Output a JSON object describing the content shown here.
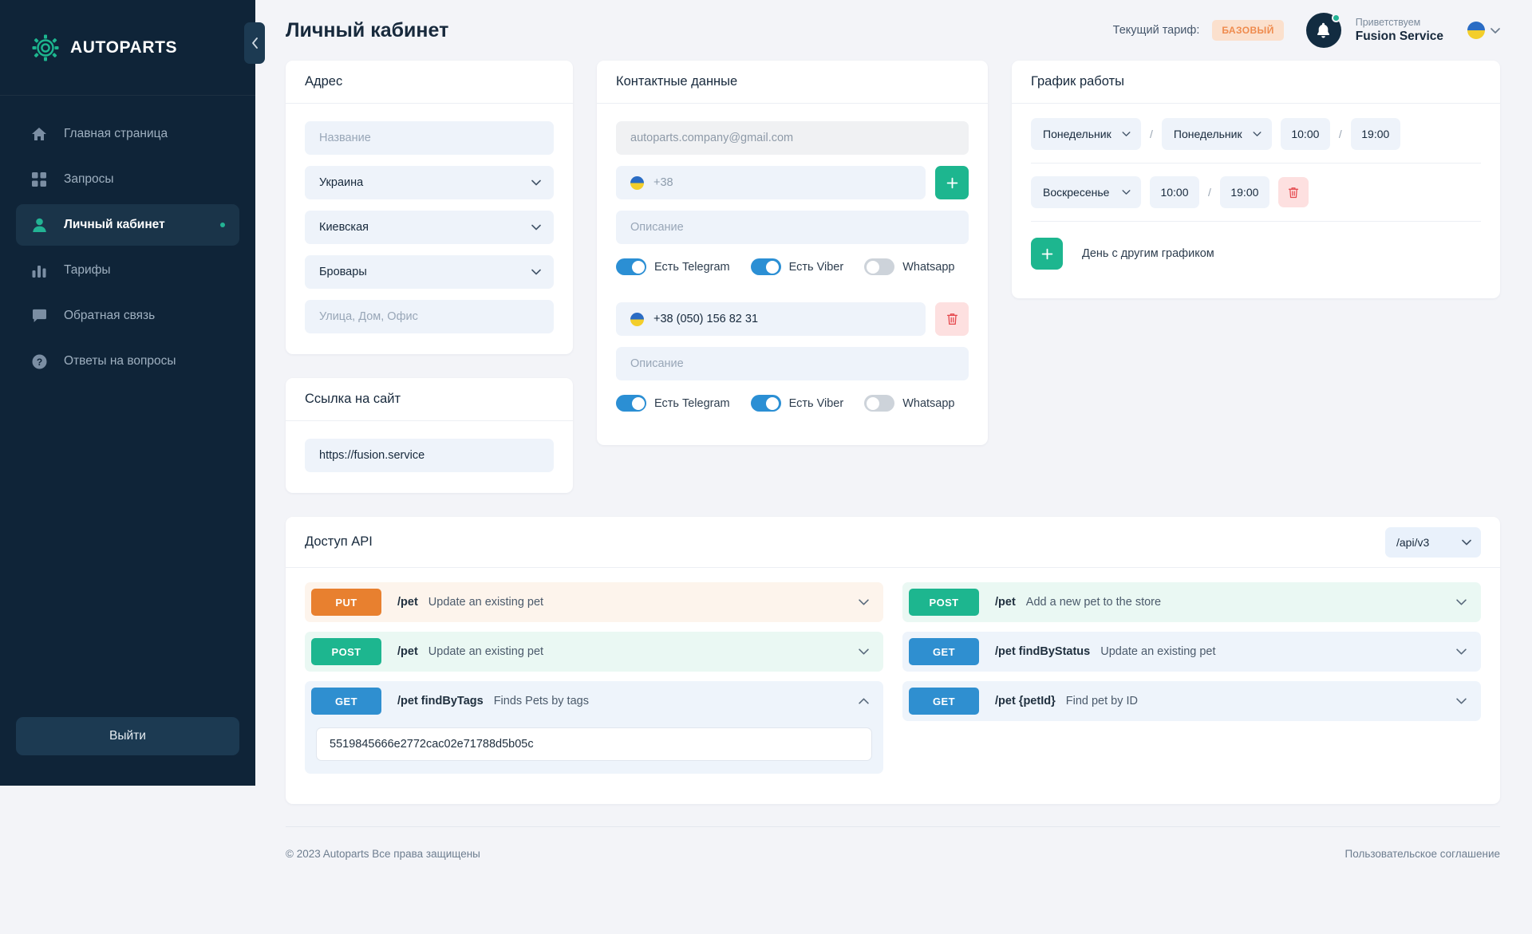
{
  "brand": {
    "name": "AUTOPARTS",
    "logo_icon": "gear-logo-icon"
  },
  "sidebar": {
    "collapse_icon": "chevron-left-icon",
    "items": [
      {
        "label": "Главная страница",
        "icon": "home-icon",
        "active": false
      },
      {
        "label": "Запросы",
        "icon": "grid-icon",
        "active": false
      },
      {
        "label": "Личный кабинет",
        "icon": "user-icon",
        "active": true
      },
      {
        "label": "Тарифы",
        "icon": "bar-chart-icon",
        "active": false
      },
      {
        "label": "Обратная связь",
        "icon": "chat-icon",
        "active": false
      },
      {
        "label": "Ответы на вопросы",
        "icon": "question-circle-icon",
        "active": false
      }
    ],
    "logout_label": "Выйти"
  },
  "header": {
    "page_title": "Личный кабинет",
    "tariff_label": "Текущий тариф:",
    "tariff_badge": "БАЗОВЫЙ",
    "bell_icon": "bell-icon",
    "greeting_small": "Приветствуем",
    "greeting_name": "Fusion Service",
    "lang_flag": "ukraine-flag-icon",
    "lang_chevron": "chevron-down-icon"
  },
  "address": {
    "title": "Адрес",
    "name_placeholder": "Название",
    "country": "Украина",
    "region": "Киевская",
    "city": "Бровары",
    "street_placeholder": "Улица, Дом, Офис"
  },
  "website": {
    "title": "Ссылка на сайт",
    "url": "https://fusion.service"
  },
  "contacts": {
    "title": "Контактные данные",
    "email_placeholder": "autoparts.company@gmail.com",
    "add_icon": "plus-icon",
    "delete_icon": "trash-icon",
    "blocks": [
      {
        "phone": "+38",
        "phone_is_placeholder": true,
        "description_placeholder": "Описание",
        "action": "add",
        "toggles": [
          {
            "label": "Есть Telegram",
            "on": true
          },
          {
            "label": "Есть Viber",
            "on": true
          },
          {
            "label": "Whatsapp",
            "on": false
          }
        ]
      },
      {
        "phone": "+38 (050) 156 82 31",
        "phone_is_placeholder": false,
        "description_placeholder": "Описание",
        "action": "delete",
        "toggles": [
          {
            "label": "Есть Telegram",
            "on": true
          },
          {
            "label": "Есть Viber",
            "on": true
          },
          {
            "label": "Whatsapp",
            "on": false
          }
        ]
      }
    ]
  },
  "schedule": {
    "title": "График работы",
    "separator": "/",
    "rows": [
      {
        "day_from": "Понедельник",
        "day_to": "Понедельник",
        "time_from": "10:00",
        "time_to": "19:00",
        "has_delete": false
      },
      {
        "day_from": "Воскресенье",
        "day_to": null,
        "time_from": "10:00",
        "time_to": "19:00",
        "has_delete": true
      }
    ],
    "add_label": "День с другим графиком",
    "add_icon": "plus-icon",
    "delete_icon": "trash-icon"
  },
  "api": {
    "title": "Доступ API",
    "version": "/api/v3",
    "version_chevron": "chevron-down-icon",
    "left_rows": [
      {
        "verb": "PUT",
        "path": "/pet",
        "desc": "Update an existing pet",
        "expanded": false
      },
      {
        "verb": "POST",
        "path": "/pet",
        "desc": "Update an existing pet",
        "expanded": false
      },
      {
        "verb": "GET",
        "path": "/pet findByTags",
        "desc": "Finds Pets by tags",
        "expanded": true,
        "key": "5519845666e2772cac02e71788d5b05c"
      }
    ],
    "right_rows": [
      {
        "verb": "POST",
        "path": "/pet",
        "desc": "Add a new pet to the store",
        "expanded": false
      },
      {
        "verb": "GET",
        "path": "/pet findByStatus",
        "desc": "Update an existing pet",
        "expanded": false
      },
      {
        "verb": "GET",
        "path": "/pet {petId}",
        "desc": "Find pet by ID",
        "expanded": false
      }
    ]
  },
  "footer": {
    "copyright": "© 2023 Autoparts Все права защищены",
    "agreement": "Пользовательское соглашение"
  },
  "colors": {
    "accent_green": "#1db68f",
    "sidebar_bg": "#0f2438",
    "badge_orange": "#ef8b4e",
    "toggle_on": "#2b8fd4",
    "verb_put": "#e8802f",
    "verb_post": "#1db68f",
    "verb_get": "#2f8fd0"
  }
}
